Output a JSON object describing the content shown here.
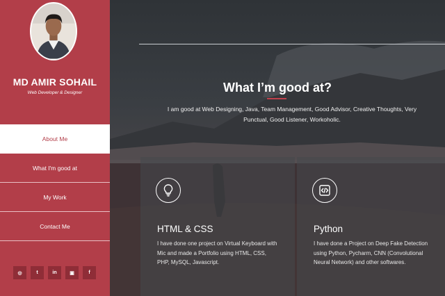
{
  "profile": {
    "name": "MD AMIR SOHAIL",
    "role": "Web Developer & Designer"
  },
  "nav": {
    "items": [
      {
        "label": "About Me",
        "active": true
      },
      {
        "label": "What I'm good at",
        "active": false
      },
      {
        "label": "My Work",
        "active": false
      },
      {
        "label": "Contact Me",
        "active": false
      }
    ]
  },
  "socials": [
    {
      "icon": "github-icon",
      "glyph": "◎"
    },
    {
      "icon": "twitter-icon",
      "glyph": "t"
    },
    {
      "icon": "linkedin-icon",
      "glyph": "in"
    },
    {
      "icon": "instagram-icon",
      "glyph": "▣"
    },
    {
      "icon": "facebook-icon",
      "glyph": "f"
    }
  ],
  "section": {
    "title": "What I’m good at?",
    "intro": "I am good at Web Designing, Java, Team Management, Good Advisor, Creative Thoughts, Very Punctual, Good Listener, Workoholic."
  },
  "cards": [
    {
      "icon": "lightbulb-icon",
      "title": "HTML & CSS",
      "text": "I have done one project on Virtual Keyboard with Mic and made a Portfolio using HTML, CSS, PHP, MySQL, Javascript."
    },
    {
      "icon": "code-icon",
      "title": "Python",
      "text": "I have done a Project on Deep Fake Detection using Python, Pycharm, CNN (Convolutional Neural Network) and other softwares."
    }
  ],
  "colors": {
    "sidebar": "#b23e49",
    "accent": "#c0414d",
    "social_bg": "#8f2d37"
  }
}
